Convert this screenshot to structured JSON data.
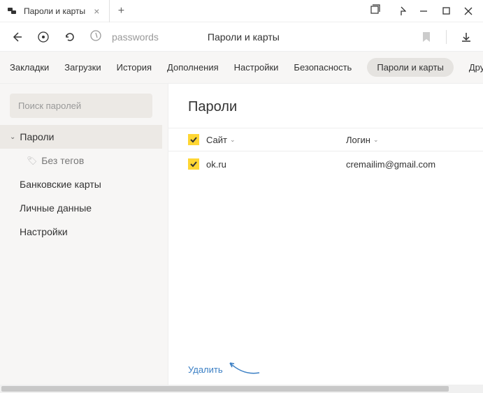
{
  "window": {
    "tab_title": "Пароли и карты"
  },
  "toolbar": {
    "url_path": "passwords",
    "page_title": "Пароли и карты"
  },
  "nav": {
    "items": [
      "Закладки",
      "Загрузки",
      "История",
      "Дополнения",
      "Настройки",
      "Безопасность",
      "Пароли и карты",
      "Други"
    ]
  },
  "sidebar": {
    "search_placeholder": "Поиск паролей",
    "items": [
      {
        "label": "Пароли",
        "type": "expandable"
      },
      {
        "label": "Без тегов",
        "type": "sub"
      },
      {
        "label": "Банковские карты",
        "type": "normal"
      },
      {
        "label": "Личные данные",
        "type": "normal"
      },
      {
        "label": "Настройки",
        "type": "normal"
      }
    ]
  },
  "content": {
    "heading": "Пароли",
    "columns": {
      "site": "Сайт",
      "login": "Логин"
    },
    "rows": [
      {
        "site": "ok.ru",
        "login": "cremailim@gmail.com",
        "checked": true
      }
    ],
    "delete_label": "Удалить"
  }
}
